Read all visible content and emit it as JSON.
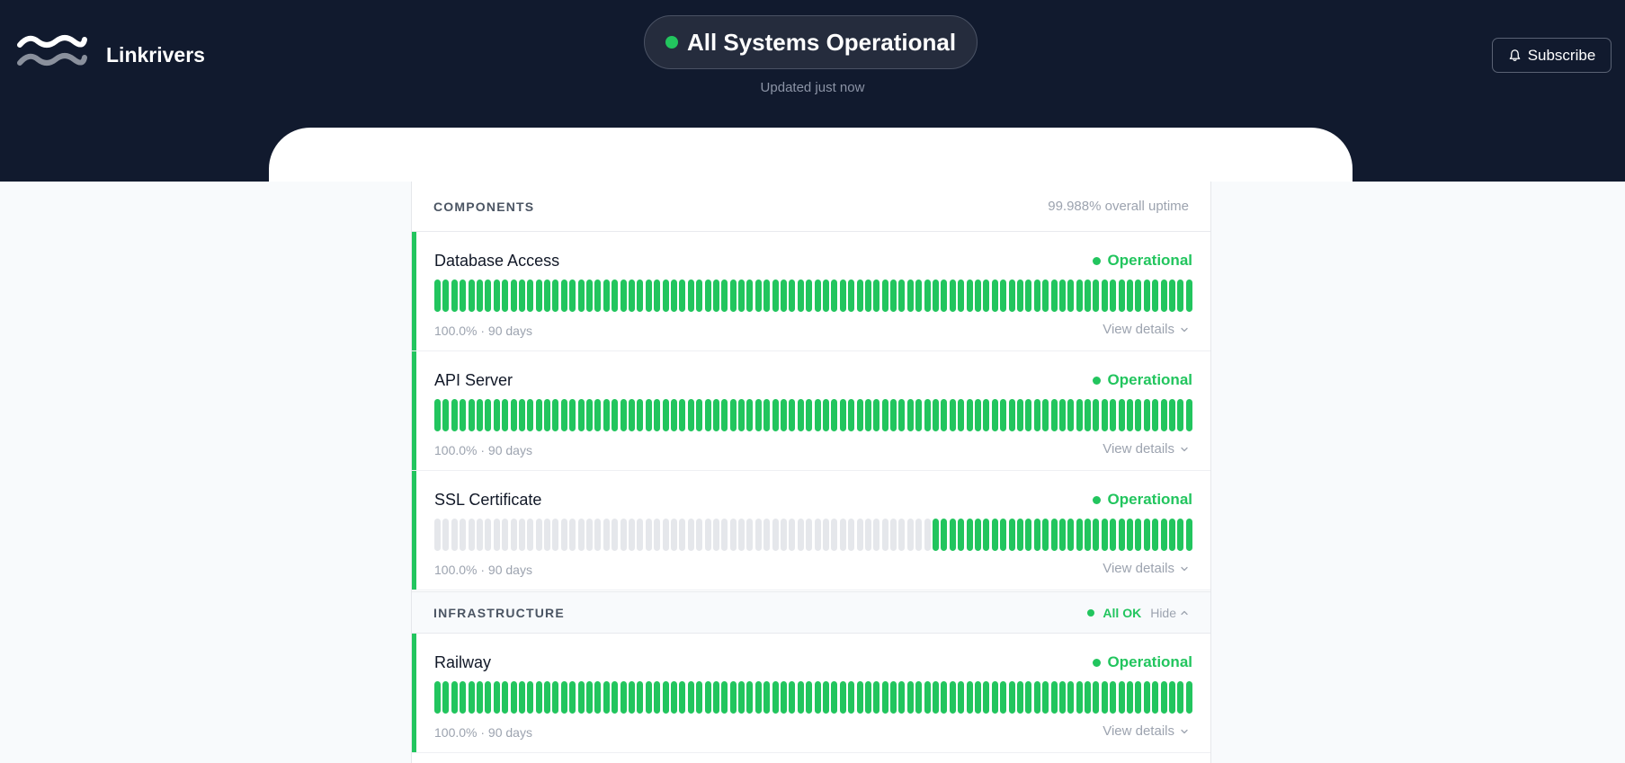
{
  "brand": {
    "name": "Linkrivers",
    "logo_icon": "waves-logo-icon"
  },
  "status": {
    "text": "All Systems Operational",
    "updated": "Updated just now",
    "color": "#22c55e"
  },
  "subscribe": {
    "label": "Subscribe",
    "icon": "bell-icon"
  },
  "components_section": {
    "title": "COMPONENTS",
    "uptime": "99.988% overall uptime"
  },
  "components": [
    {
      "name": "Database Access",
      "status": "Operational",
      "uptime": "100.0%",
      "period": "· 90 days",
      "details": "View details",
      "no_data_days": 0
    },
    {
      "name": "API Server",
      "status": "Operational",
      "uptime": "100.0%",
      "period": "· 90 days",
      "details": "View details",
      "no_data_days": 0
    },
    {
      "name": "SSL Certificate",
      "status": "Operational",
      "uptime": "100.0%",
      "period": "· 90 days",
      "details": "View details",
      "no_data_days": 59
    }
  ],
  "infrastructure_section": {
    "title": "INFRASTRUCTURE",
    "status": "All OK",
    "toggle": "Hide"
  },
  "infrastructure": [
    {
      "name": "Railway",
      "status": "Operational",
      "uptime": "100.0%",
      "period": "· 90 days",
      "details": "View details",
      "no_data_days": 0
    }
  ],
  "days_shown": 90,
  "colors": {
    "operational": "#22c55e",
    "no_data": "#e5e7eb",
    "header_bg": "#111a2e"
  }
}
